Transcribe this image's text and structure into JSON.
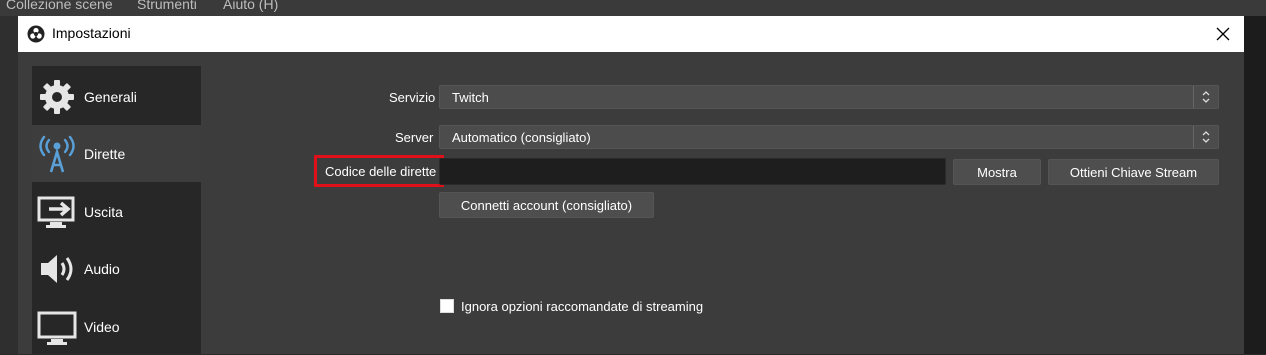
{
  "menubar": {
    "items": [
      "Collezione scene",
      "Strumenti",
      "Aiuto (H)"
    ]
  },
  "dialog": {
    "title": "Impostazioni",
    "close_icon": "close-icon",
    "logo_icon": "obs-logo"
  },
  "sidebar": {
    "items": [
      {
        "label": "Generali",
        "icon": "gear-icon",
        "active": false
      },
      {
        "label": "Dirette",
        "icon": "broadcast-tower-icon",
        "active": true
      },
      {
        "label": "Uscita",
        "icon": "output-monitor-icon",
        "active": false
      },
      {
        "label": "Audio",
        "icon": "speaker-icon",
        "active": false
      },
      {
        "label": "Video",
        "icon": "monitor-icon",
        "active": false
      }
    ]
  },
  "stream": {
    "service_label": "Servizio",
    "service_value": "Twitch",
    "server_label": "Server",
    "server_value": "Automatico (consigliato)",
    "key_label": "Codice delle dirette",
    "key_value": "",
    "show_button": "Mostra",
    "get_key_button": "Ottieni Chiave Stream",
    "connect_button": "Connetti account (consigliato)",
    "ignore_checkbox_label": "Ignora opzioni raccomandate di streaming",
    "ignore_checked": false
  },
  "colors": {
    "highlight": "#e0101a",
    "dialog_bg": "#3c3c3c",
    "sidebar_bg": "#272727"
  }
}
